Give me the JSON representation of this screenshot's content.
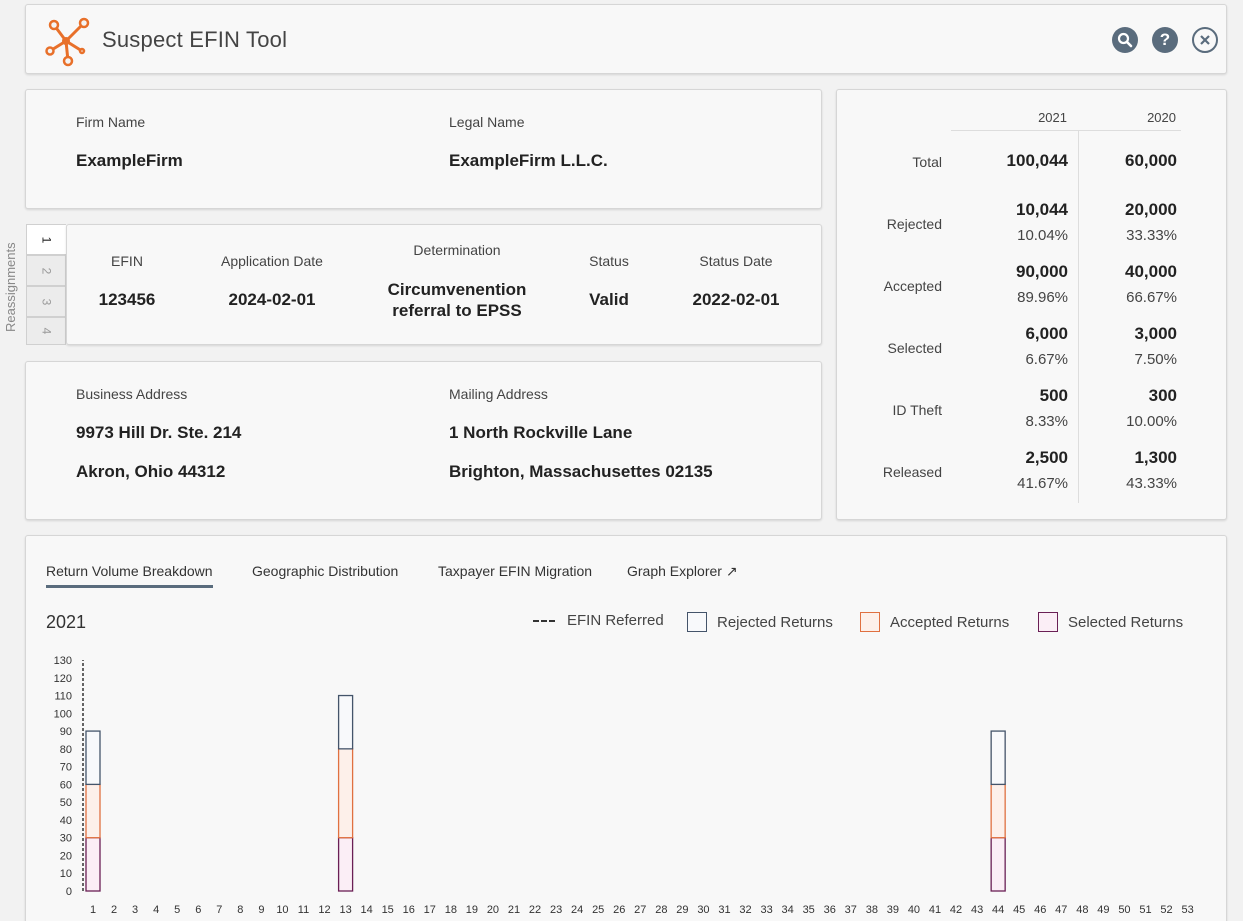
{
  "app": {
    "title": "Suspect EFIN Tool"
  },
  "header_buttons": {
    "search": "search-icon",
    "help": "?",
    "close": "⊗"
  },
  "firm": {
    "firm_name_label": "Firm Name",
    "firm_name": "ExampleFirm",
    "legal_name_label": "Legal Name",
    "legal_name": "ExampleFirm L.L.C."
  },
  "reassignments": {
    "label": "Reassignments",
    "tabs": [
      "1",
      "2",
      "3",
      "4"
    ]
  },
  "efin": {
    "efin_label": "EFIN",
    "efin": "123456",
    "app_date_label": "Application Date",
    "app_date": "2024-02-01",
    "determination_label": "Determination",
    "determination": "Circumvenention referral to EPSS",
    "status_label": "Status",
    "status": "Valid",
    "status_date_label": "Status Date",
    "status_date": "2022-02-01"
  },
  "address": {
    "business_label": "Business Address",
    "business_line1": "9973 Hill Dr. Ste. 214",
    "business_line2": "Akron, Ohio 44312",
    "mailing_label": "Mailing Address",
    "mailing_line1": "1 North Rockville Lane",
    "mailing_line2": "Brighton, Massachusettes 02135"
  },
  "stats": {
    "years": [
      "2021",
      "2020"
    ],
    "rows": [
      {
        "label": "Total",
        "v2021": "100,044",
        "p2021": "",
        "v2020": "60,000",
        "p2020": ""
      },
      {
        "label": "Rejected",
        "v2021": "10,044",
        "p2021": "10.04%",
        "v2020": "20,000",
        "p2020": "33.33%"
      },
      {
        "label": "Accepted",
        "v2021": "90,000",
        "p2021": "89.96%",
        "v2020": "40,000",
        "p2020": "66.67%"
      },
      {
        "label": "Selected",
        "v2021": "6,000",
        "p2021": "6.67%",
        "v2020": "3,000",
        "p2020": "7.50%"
      },
      {
        "label": "ID Theft",
        "v2021": "500",
        "p2021": "8.33%",
        "v2020": "300",
        "p2020": "10.00%"
      },
      {
        "label": "Released",
        "v2021": "2,500",
        "p2021": "41.67%",
        "v2020": "1,300",
        "p2020": "43.33%"
      }
    ]
  },
  "tabs": [
    {
      "label": "Return Volume Breakdown"
    },
    {
      "label": "Geographic Distribution"
    },
    {
      "label": "Taxpayer EFIN Migration"
    },
    {
      "label": "Graph Explorer ↗"
    }
  ],
  "legend": {
    "efin_referred": "EFIN Referred",
    "rejected": "Rejected Returns",
    "accepted": "Accepted Returns",
    "selected": "Selected Returns"
  },
  "colors": {
    "rejected": "#44546a",
    "accepted": "#e07040",
    "selected": "#6a1f55",
    "accent": "#5a6c7d",
    "logo": "#e8702a"
  },
  "chart_data": {
    "type": "bar",
    "stacked": true,
    "title": "2021",
    "ylim": [
      0,
      130
    ],
    "yticks": [
      0,
      10,
      20,
      30,
      40,
      50,
      60,
      70,
      80,
      90,
      100,
      110,
      120,
      130
    ],
    "weeks": 53,
    "efin_referred_week": 1,
    "series": [
      {
        "name": "Selected Returns",
        "points": [
          {
            "week": 1,
            "value": 30
          },
          {
            "week": 13,
            "value": 30
          },
          {
            "week": 44,
            "value": 30
          }
        ]
      },
      {
        "name": "Accepted Returns",
        "points": [
          {
            "week": 1,
            "value": 30
          },
          {
            "week": 13,
            "value": 50
          },
          {
            "week": 44,
            "value": 30
          }
        ]
      },
      {
        "name": "Rejected Returns",
        "points": [
          {
            "week": 1,
            "value": 30
          },
          {
            "week": 13,
            "value": 30
          },
          {
            "week": 44,
            "value": 30
          }
        ]
      }
    ]
  }
}
